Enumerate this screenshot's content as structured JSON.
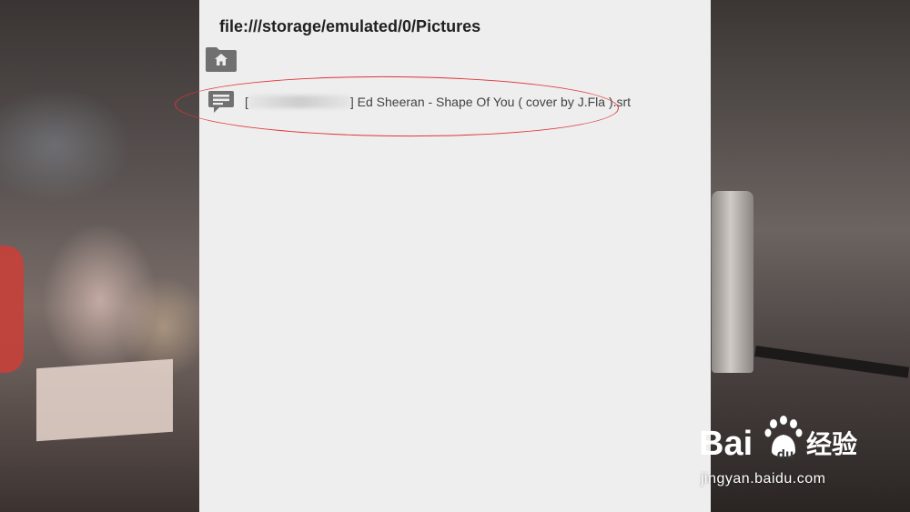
{
  "dialog": {
    "path": "file:///storage/emulated/0/Pictures",
    "home_icon": "folder-home-icon",
    "files": [
      {
        "icon": "subtitle-icon",
        "name_prefix": "[",
        "name_suffix": "] Ed Sheeran - Shape Of You ( cover by J.Fla ).srt"
      }
    ]
  },
  "watermark": {
    "brand": "Baidu 经验",
    "url": "jingyan.baidu.com"
  },
  "colors": {
    "dialog_bg": "#eeeeee",
    "icon_gray": "#707070",
    "annotation_red": "#e0343a"
  }
}
